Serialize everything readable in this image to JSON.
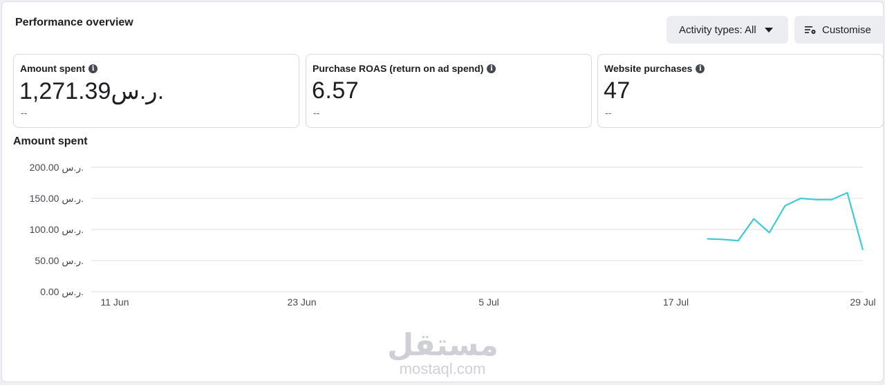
{
  "header": {
    "title": "Performance overview",
    "activity_button": "Activity types: All",
    "customise_button": "Customise"
  },
  "cards": [
    {
      "label": "Amount spent",
      "value": "1,271.39ر.س.",
      "delta": "--"
    },
    {
      "label": "Purchase ROAS (return on ad spend)",
      "value": "6.57",
      "delta": "--"
    },
    {
      "label": "Website purchases",
      "value": "47",
      "delta": "--"
    }
  ],
  "chart_section": {
    "title": "Amount spent"
  },
  "colors": {
    "line": "#3ecbd1",
    "grid": "#dadde1"
  },
  "chart_data": {
    "type": "line",
    "title": "Amount spent",
    "y_tick_labels": [
      "200.00 ر.س.",
      "150.00 ر.س.",
      "100.00 ر.س.",
      "50.00 ر.س.",
      "0.00 ر.س."
    ],
    "y_ticks": [
      200,
      150,
      100,
      50,
      0
    ],
    "ylim": [
      0,
      200
    ],
    "x_tick_labels": [
      "11 Jun",
      "23 Jun",
      "5 Jul",
      "17 Jul",
      "29 Jul"
    ],
    "grid": true,
    "series": [
      {
        "x": [
          "19 Jul",
          "20 Jul",
          "21 Jul",
          "22 Jul",
          "23 Jul",
          "24 Jul",
          "25 Jul",
          "26 Jul",
          "27 Jul",
          "28 Jul",
          "29 Jul"
        ],
        "values": [
          85,
          84,
          82,
          117,
          95,
          138,
          150,
          148,
          148,
          159,
          67
        ]
      }
    ]
  },
  "watermark": {
    "arabic": "مستقل",
    "latin": "mostaql.com"
  }
}
